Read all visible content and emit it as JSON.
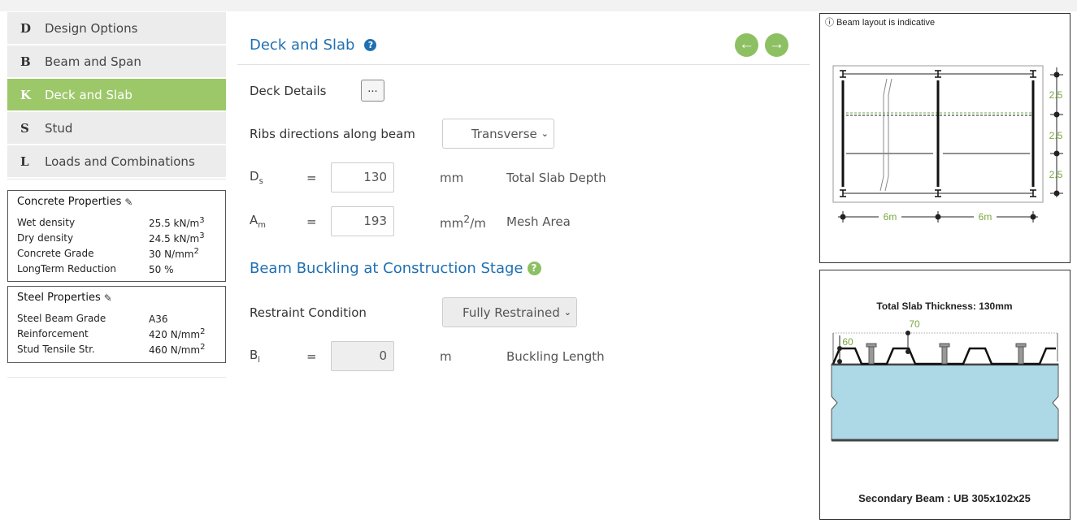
{
  "nav": [
    {
      "key": "D",
      "label": "Design Options",
      "active": false
    },
    {
      "key": "B",
      "label": "Beam and Span",
      "active": false
    },
    {
      "key": "K",
      "label": "Deck and Slab",
      "active": true
    },
    {
      "key": "S",
      "label": "Stud",
      "active": false
    },
    {
      "key": "L",
      "label": "Loads and Combinations",
      "active": false
    }
  ],
  "concrete": {
    "title": "Concrete Properties",
    "rows": [
      {
        "k": "Wet density",
        "v": "25.5 kN/m",
        "sup": "3"
      },
      {
        "k": "Dry density",
        "v": "24.5 kN/m",
        "sup": "3"
      },
      {
        "k": "Concrete Grade",
        "v": "30 N/mm",
        "sup": "2"
      },
      {
        "k": "LongTerm Reduction",
        "v": "50 %",
        "sup": ""
      }
    ]
  },
  "steel": {
    "title": "Steel Properties",
    "rows": [
      {
        "k": "Steel Beam Grade",
        "v": "A36",
        "sup": ""
      },
      {
        "k": "Reinforcement",
        "v": "420 N/mm",
        "sup": "2"
      },
      {
        "k": "Stud Tensile Str.",
        "v": "460 N/mm",
        "sup": "2"
      }
    ]
  },
  "main": {
    "title": "Deck and Slab",
    "help": "?",
    "prev_icon": "arrow-left",
    "next_icon": "arrow-right",
    "deck_details_label": "Deck Details",
    "deck_details_button": "...",
    "ribs_label": "Ribs directions along beam",
    "ribs_value": "Transverse",
    "ds": {
      "sym": "D",
      "sub": "s",
      "eq": "=",
      "value": "130",
      "unit": "mm",
      "desc": "Total Slab Depth"
    },
    "am": {
      "sym": "A",
      "sub": "m",
      "eq": "=",
      "value": "193",
      "unit": "mm",
      "unit_sup": "2",
      "unit_tail": "/m",
      "desc": "Mesh Area"
    },
    "buckling_title": "Beam Buckling at Construction Stage",
    "restraint_label": "Restraint Condition",
    "restraint_value": "Fully Restrained",
    "bl": {
      "sym": "B",
      "sub": "l",
      "eq": "=",
      "value": "0",
      "unit": "m",
      "desc": "Buckling Length"
    }
  },
  "diagram1": {
    "note": "ⓘ Beam layout is indicative",
    "spacing_labels": [
      "2.5",
      "2.5",
      "2.5"
    ],
    "span_labels": [
      "6m",
      "6m"
    ]
  },
  "diagram2": {
    "title": "Total Slab Thickness: 130mm",
    "dim_top": "70",
    "dim_left": "60",
    "caption": "Secondary Beam : UB 305x102x25"
  },
  "colors": {
    "accent_green": "#9cc86a",
    "link_blue": "#1f6fb2",
    "dim_green": "#7aa83c",
    "concrete": "#add8e6"
  }
}
